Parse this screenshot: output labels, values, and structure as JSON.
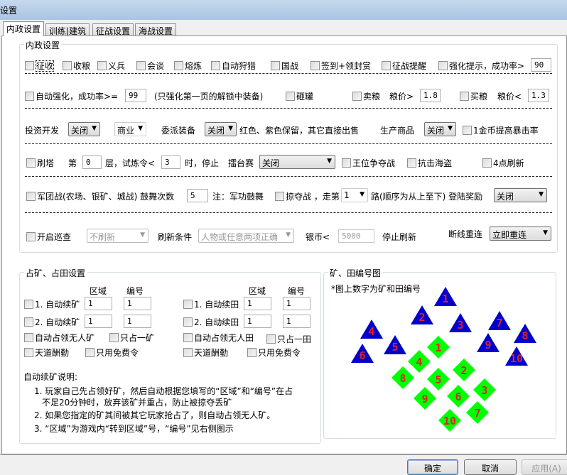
{
  "window": {
    "title": "设置"
  },
  "tabs": [
    "内政设置",
    "训练|建筑",
    "征战设置",
    "海战设置"
  ],
  "interior": {
    "group_title": "内政设置",
    "row1": [
      "征收",
      "收粮",
      "义兵",
      "会谈",
      "熔炼",
      "自动狩猎",
      "国战",
      "签到+领封赏",
      "征战提醒",
      "强化提示，成功率>"
    ],
    "row1_rate": "90",
    "auto_enhance": "自动强化，成功率>=",
    "auto_enhance_rate": "99",
    "auto_enhance_note": "(只强化第一页的解锁中装备)",
    "smash": "砸罐",
    "sell_grain": "卖粮",
    "sell_price_label": "粮价>",
    "sell_price": "1.8",
    "buy_grain": "买粮",
    "buy_price_label": "粮价<",
    "buy_price": "1.3",
    "invest_label": "投资开发",
    "invest_value": "关闭",
    "invest_type": "商业",
    "assign_label": "委派装备",
    "assign_value": "关闭",
    "assign_note": "红色、紫色保留，其它直接出售",
    "produce_label": "生产商品",
    "produce_value": "关闭",
    "gold_crit": "1金币提高暴击率",
    "tower": "刷塔",
    "tower_floor_pre": "第",
    "tower_floor": "0",
    "tower_mid": "层，试炼令<",
    "tower_tokens": "3",
    "tower_post": "时，停止",
    "arena_label": "擂台赛",
    "arena_value": "关闭",
    "throne": "王位争夺战",
    "pirates": "抗击海盗",
    "refresh4": "4点刷新",
    "legion": "军团战(农场、银矿、城战) 鼓舞次数",
    "legion_count": "5",
    "legion_note": "注：军功鼓舞",
    "plunder": "掠夺战 ，走第",
    "plunder_route": "1",
    "plunder_note": "路(顺序为从上至下) 登陆奖励",
    "login_reward": "关闭",
    "patrol": "开启巡查",
    "patrol_value": "不刷新",
    "refresh_cond_label": "刷新条件",
    "refresh_cond": "人物或任意两项正确",
    "silver_label": "银币<",
    "silver": "5000",
    "stop_refresh": "停止刷新",
    "reconnect_label": "断线重连",
    "reconnect_value": "立即重连"
  },
  "occupy": {
    "group_title": "占矿、占田设置",
    "col_region": "区域",
    "col_number": "编号",
    "mine1": "1. 自动续矿",
    "mine1_region": "1",
    "mine1_number": "1",
    "mine2": "2. 自动续矿",
    "mine2_region": "1",
    "mine2_number": "1",
    "field1": "1. 自动续田",
    "field1_region": "1",
    "field1_number": "1",
    "field2": "2. 自动续田",
    "field2_region": "1",
    "field2_number": "1",
    "auto_mine": "自动占领无人矿",
    "one_mine": "只占一矿",
    "auto_field": "自动占领无人田",
    "one_field": "只占一田",
    "tiandao1": "天道酬勤",
    "free1": "只用免费令",
    "tiandao2": "天道酬勤",
    "free2": "只用免费令",
    "notes_title": "自动续矿说明:",
    "notes": [
      "1. 玩家自己先占领好矿，然后自动根据您填写的“区域”和“编号”在占",
      "不足20分钟时，放弃该矿并重占，防止被掠夺丢矿",
      "2. 如果您指定的矿其间被其它玩家抢占了，则自动占领无人矿。",
      "3. “区域”为游戏内“转到区域”号，“编号”见右侧图示"
    ]
  },
  "map": {
    "group_title": "矿、田编号图",
    "note": "*图上数字为矿和田编号",
    "mines": [
      1,
      2,
      3,
      4,
      5,
      6,
      7,
      8,
      9,
      10
    ],
    "fields": [
      1,
      2,
      3,
      4,
      5,
      6,
      7,
      8,
      9,
      10
    ],
    "colors": {
      "mine": "#0000cc",
      "field": "#00ff00",
      "number": "#e0202a"
    }
  },
  "buttons": {
    "ok": "确定",
    "cancel": "取消",
    "apply": "应用(A)"
  }
}
